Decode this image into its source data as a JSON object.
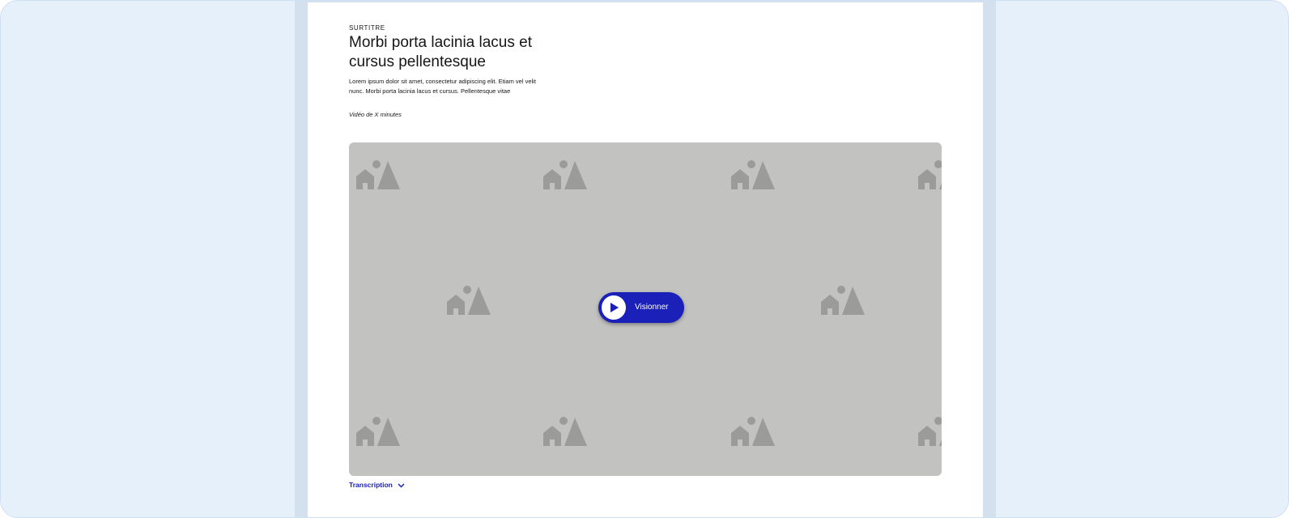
{
  "section": {
    "overline": "SURTITRE",
    "title": "Morbi porta lacinia lacus et cursus pellentesque",
    "description": "Lorem ipsum dolor sit amet, consectetur adipiscing elit. Etiam vel velit nunc. Morbi porta lacinia lacus et cursus. Pellentesque vitae",
    "duration": "Vidéo de X minutes"
  },
  "video": {
    "play_label": "Visionner",
    "placeholder_icon": "image-placeholder-icon",
    "play_icon": "play-icon"
  },
  "transcript": {
    "label": "Transcription",
    "icon": "chevron-down-icon"
  },
  "colors": {
    "accent": "#1b20b8",
    "page_background": "#e6f0fb",
    "video_placeholder": "#c2c2c0",
    "placeholder_icon": "#9b9b99"
  }
}
